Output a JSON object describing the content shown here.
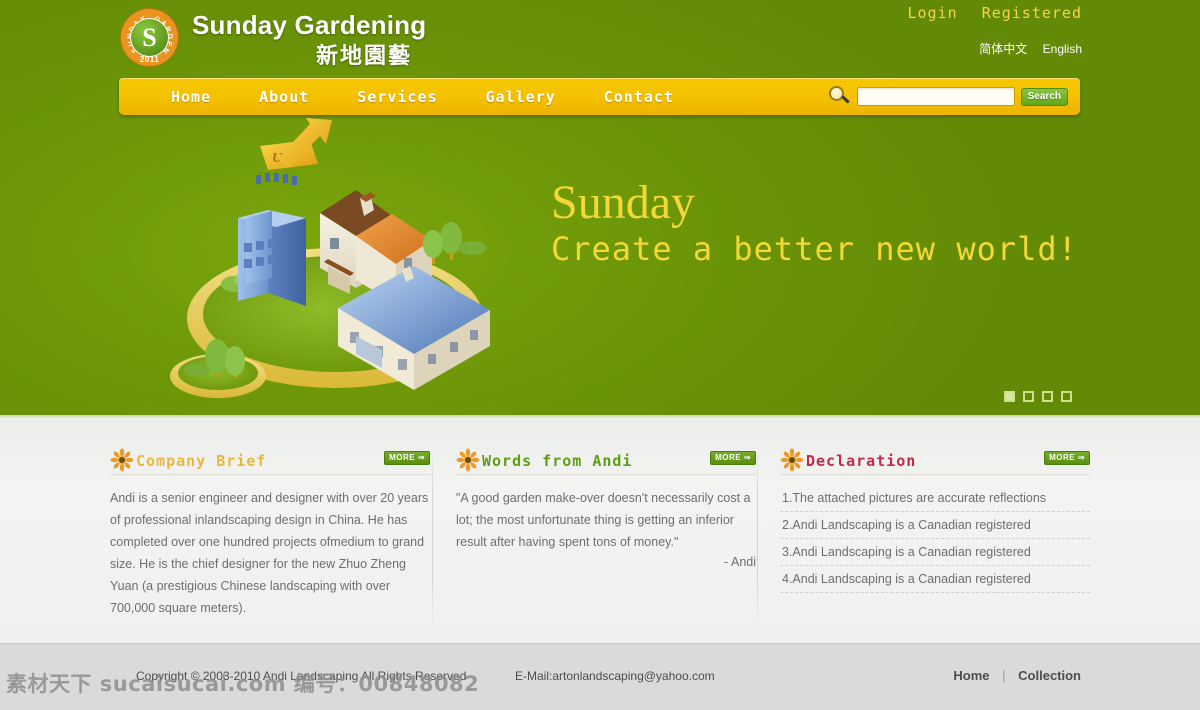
{
  "brand": {
    "name_en": "Sunday Gardening",
    "name_cn": "新地園藝",
    "logo_arc": "SUNDAY GARDEN",
    "logo_year": "2011",
    "logo_mark": "S"
  },
  "topbar": {
    "login": "Login",
    "registered": "Registered",
    "lang_cn": "简体中文",
    "lang_en": "English"
  },
  "nav": {
    "items": [
      {
        "label": "Home"
      },
      {
        "label": "About"
      },
      {
        "label": "Services"
      },
      {
        "label": "Gallery"
      },
      {
        "label": "Contact"
      }
    ]
  },
  "search": {
    "value": "",
    "placeholder": "",
    "button": "Search",
    "icon": "magnifier-icon"
  },
  "hero": {
    "title": "Sunday",
    "subtitle": "Create a better new world!",
    "illustration_label": "UP",
    "slides": [
      {
        "active": true
      },
      {
        "active": false
      },
      {
        "active": false
      },
      {
        "active": false
      }
    ]
  },
  "sections": {
    "company": {
      "title": "Company Brief",
      "more": "MORE ⇒",
      "body": "Andi is a senior engineer and designer with over 20 years of professional inlandscaping design in China. He has completed over one hundred projects ofmedium to grand size. He is the chief designer for the new Zhuo Zheng Yuan (a prestigious Chinese landscaping with over 700,000 square meters)."
    },
    "words": {
      "title": "Words from Andi",
      "more": "MORE ⇒",
      "body": "\"A good garden make-over doesn't necessarily cost a lot; the most unfortunate thing is getting an inferior result after having spent tons of money.\"",
      "attribution": "- Andi"
    },
    "declaration": {
      "title": "Declaration",
      "more": "MORE ⇒",
      "items": [
        "1.The attached pictures are accurate reflections",
        "2.Andi Landscaping is a Canadian registered",
        "3.Andi Landscaping is a Canadian registered",
        "4.Andi Landscaping is a Canadian registered"
      ]
    }
  },
  "footer": {
    "copyright": "Copyright © 2003-2010 Andi Landscaping All Rights Reserved",
    "email": "E-Mail:artonlandscaping@yahoo.com",
    "links": [
      {
        "label": "Home"
      },
      {
        "label": "Collection"
      }
    ],
    "separator": "|"
  },
  "watermark": "素材天下 sucaisucai.com 编号：00848082",
  "colors": {
    "green": "#6b9408",
    "yellow": "#f4c000",
    "hero_text": "#f4d935",
    "title_gold": "#e8b93c",
    "title_green": "#5e9e16",
    "title_red": "#bf2b4a",
    "footer_bg": "#d9dbd8"
  }
}
